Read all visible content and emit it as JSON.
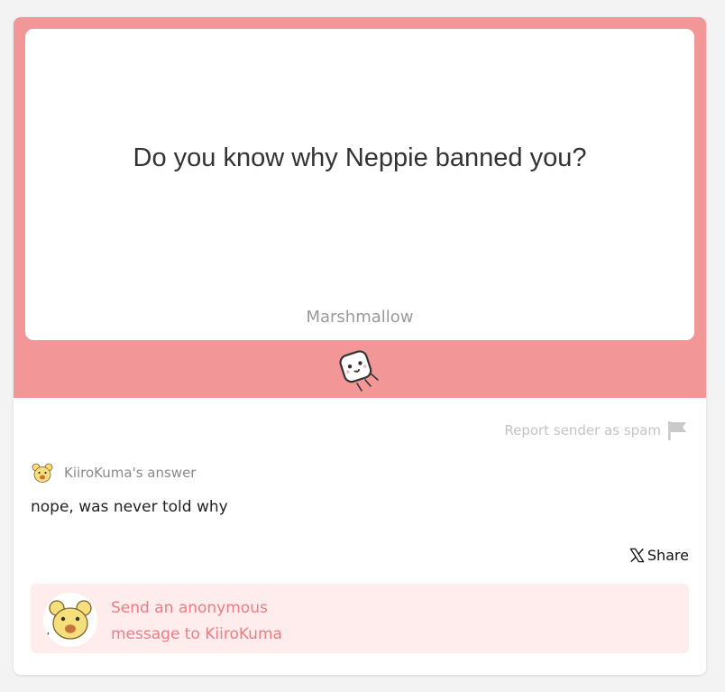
{
  "question": {
    "text": "Do you know why Neppie banned you?",
    "brand": "Marshmallow"
  },
  "report": {
    "label": "Report sender as spam",
    "icon": "flag-icon"
  },
  "answer": {
    "author_label": "KiiroKuma's answer",
    "text": "nope, was never told why"
  },
  "share": {
    "label": "Share",
    "icon": "x-logo-icon"
  },
  "send": {
    "line1": "Send an anonymous",
    "line2": "message to KiiroKuma"
  },
  "colors": {
    "band": "#f29698",
    "send_bg": "#ffeced",
    "send_text": "#ee7d83"
  }
}
